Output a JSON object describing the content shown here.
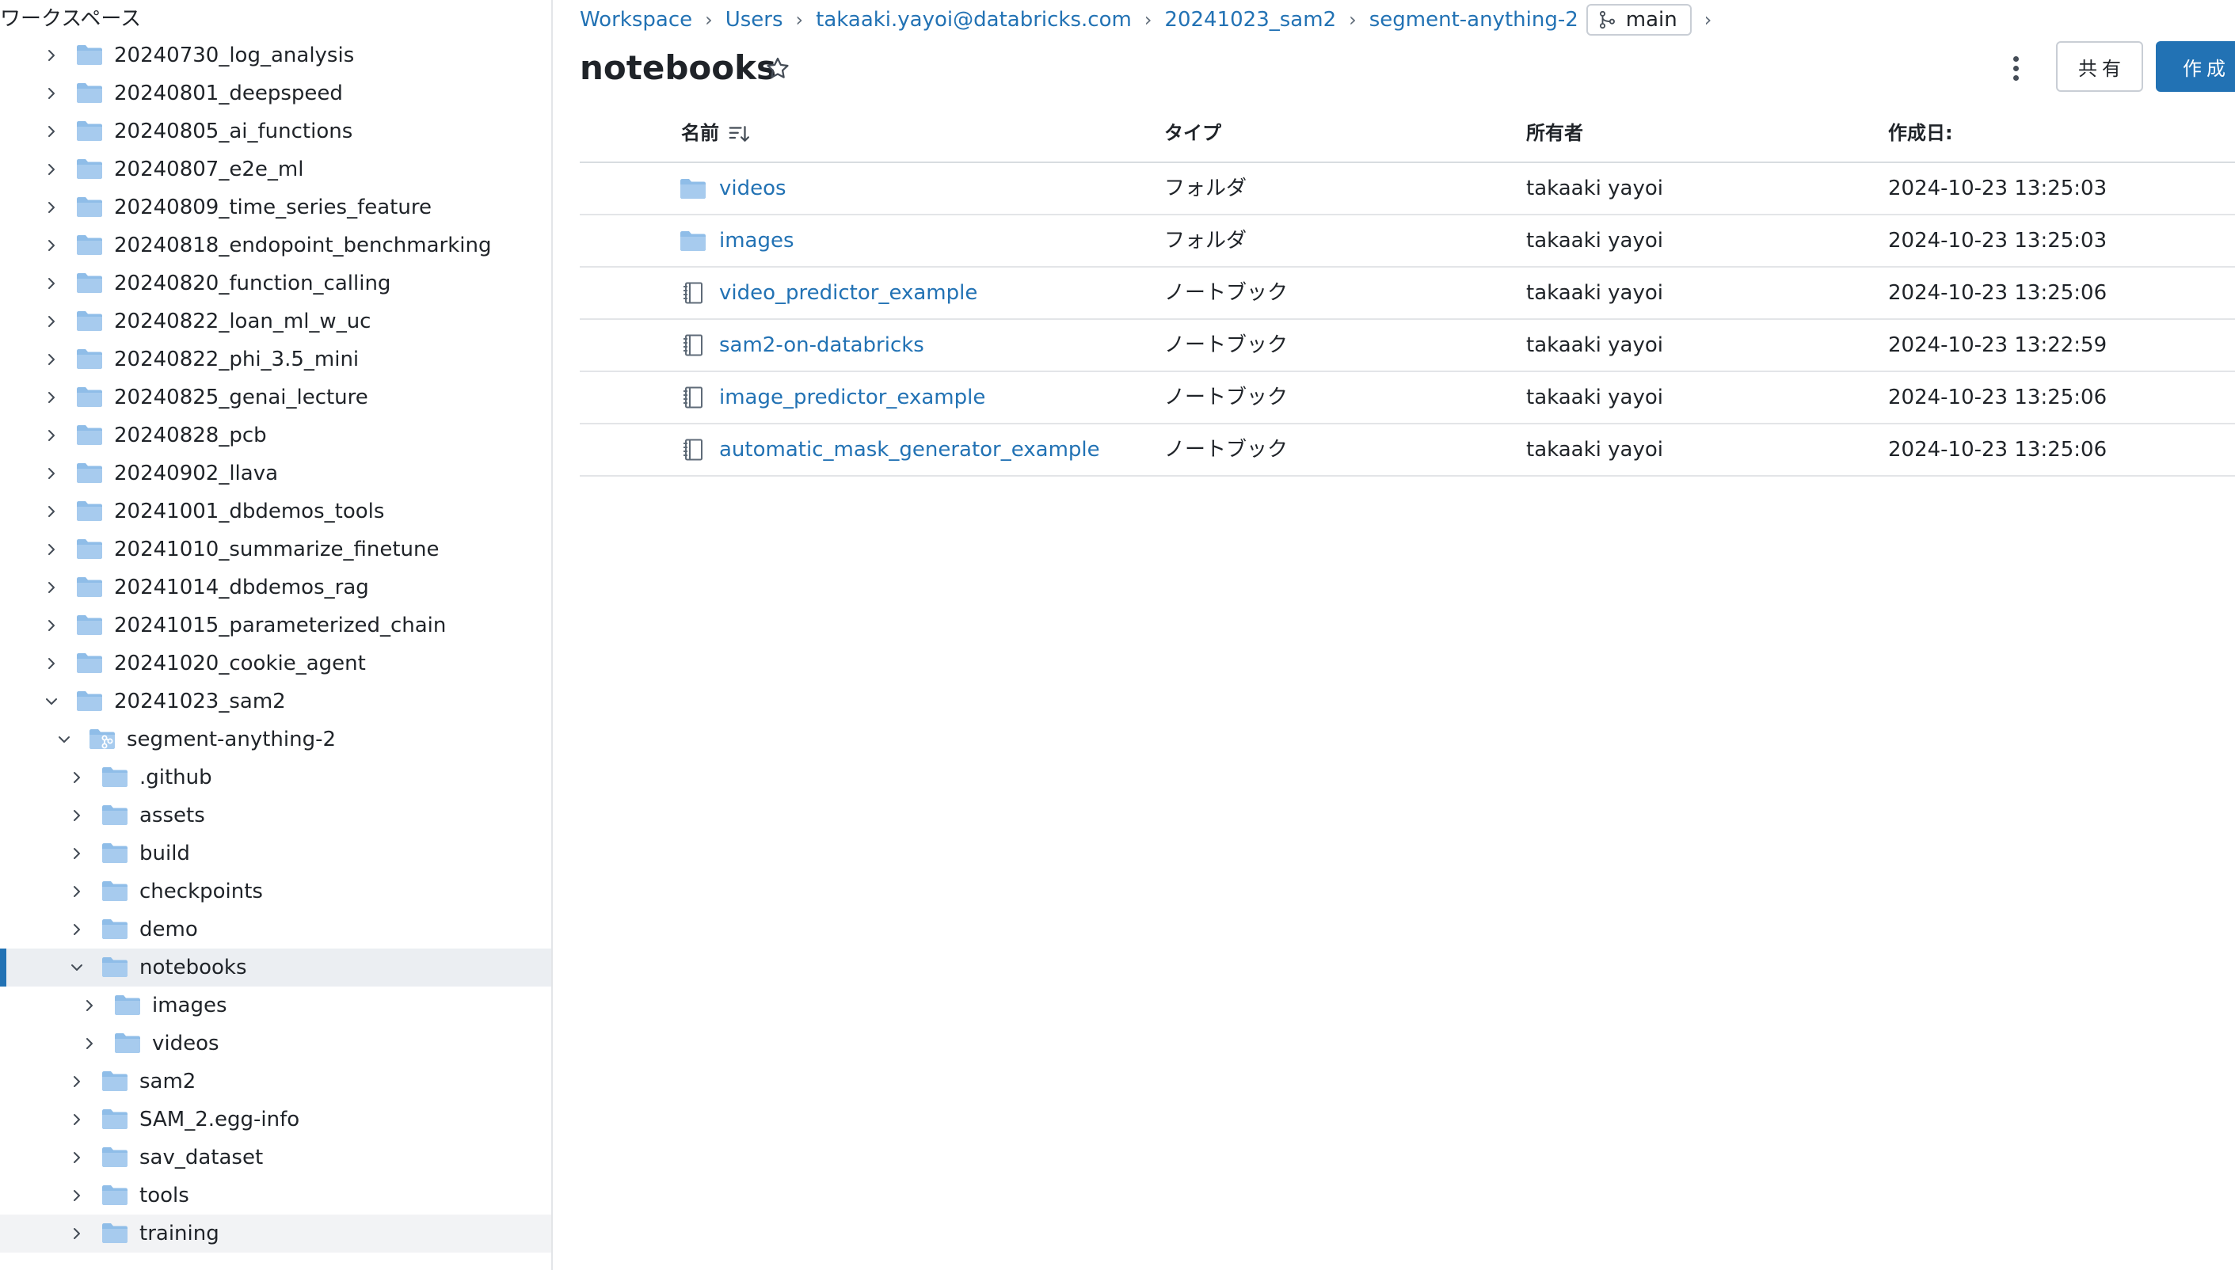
{
  "sidebar": {
    "title": "ワークスペース",
    "items": [
      {
        "label": "20240730_log_analysis",
        "level": 0,
        "expanded": false,
        "icon": "folder-icon"
      },
      {
        "label": "20240801_deepspeed",
        "level": 0,
        "expanded": false,
        "icon": "folder-icon"
      },
      {
        "label": "20240805_ai_functions",
        "level": 0,
        "expanded": false,
        "icon": "folder-icon"
      },
      {
        "label": "20240807_e2e_ml",
        "level": 0,
        "expanded": false,
        "icon": "folder-icon"
      },
      {
        "label": "20240809_time_series_feature",
        "level": 0,
        "expanded": false,
        "icon": "folder-icon"
      },
      {
        "label": "20240818_endopoint_benchmarking",
        "level": 0,
        "expanded": false,
        "icon": "folder-icon"
      },
      {
        "label": "20240820_function_calling",
        "level": 0,
        "expanded": false,
        "icon": "folder-icon"
      },
      {
        "label": "20240822_loan_ml_w_uc",
        "level": 0,
        "expanded": false,
        "icon": "folder-icon"
      },
      {
        "label": "20240822_phi_3.5_mini",
        "level": 0,
        "expanded": false,
        "icon": "folder-icon"
      },
      {
        "label": "20240825_genai_lecture",
        "level": 0,
        "expanded": false,
        "icon": "folder-icon"
      },
      {
        "label": "20240828_pcb",
        "level": 0,
        "expanded": false,
        "icon": "folder-icon"
      },
      {
        "label": "20240902_llava",
        "level": 0,
        "expanded": false,
        "icon": "folder-icon"
      },
      {
        "label": "20241001_dbdemos_tools",
        "level": 0,
        "expanded": false,
        "icon": "folder-icon"
      },
      {
        "label": "20241010_summarize_finetune",
        "level": 0,
        "expanded": false,
        "icon": "folder-icon"
      },
      {
        "label": "20241014_dbdemos_rag",
        "level": 0,
        "expanded": false,
        "icon": "folder-icon"
      },
      {
        "label": "20241015_parameterized_chain",
        "level": 0,
        "expanded": false,
        "icon": "folder-icon"
      },
      {
        "label": "20241020_cookie_agent",
        "level": 0,
        "expanded": false,
        "icon": "folder-icon"
      },
      {
        "label": "20241023_sam2",
        "level": 0,
        "expanded": true,
        "icon": "folder-icon"
      },
      {
        "label": "segment-anything-2",
        "level": 1,
        "expanded": true,
        "icon": "git-folder-icon"
      },
      {
        "label": ".github",
        "level": 2,
        "expanded": false,
        "icon": "folder-icon"
      },
      {
        "label": "assets",
        "level": 2,
        "expanded": false,
        "icon": "folder-icon"
      },
      {
        "label": "build",
        "level": 2,
        "expanded": false,
        "icon": "folder-icon"
      },
      {
        "label": "checkpoints",
        "level": 2,
        "expanded": false,
        "icon": "folder-icon"
      },
      {
        "label": "demo",
        "level": 2,
        "expanded": false,
        "icon": "folder-icon"
      },
      {
        "label": "notebooks",
        "level": 2,
        "expanded": true,
        "icon": "folder-icon",
        "selected": true
      },
      {
        "label": "images",
        "level": 3,
        "expanded": false,
        "icon": "folder-icon"
      },
      {
        "label": "videos",
        "level": 3,
        "expanded": false,
        "icon": "folder-icon"
      },
      {
        "label": "sam2",
        "level": 2,
        "expanded": false,
        "icon": "folder-icon"
      },
      {
        "label": "SAM_2.egg-info",
        "level": 2,
        "expanded": false,
        "icon": "folder-icon"
      },
      {
        "label": "sav_dataset",
        "level": 2,
        "expanded": false,
        "icon": "folder-icon"
      },
      {
        "label": "tools",
        "level": 2,
        "expanded": false,
        "icon": "folder-icon"
      },
      {
        "label": "training",
        "level": 2,
        "expanded": false,
        "icon": "folder-icon",
        "hovered": true
      }
    ]
  },
  "breadcrumb": {
    "items": [
      "Workspace",
      "Users",
      "takaaki.yayoi@databricks.com",
      "20241023_sam2",
      "segment-anything-2"
    ],
    "separator": "›",
    "branch": "main"
  },
  "header": {
    "title": "notebooks",
    "share_label": "共有",
    "create_label": "作成"
  },
  "table": {
    "columns": [
      "名前",
      "タイプ",
      "所有者",
      "作成日:"
    ],
    "rows": [
      {
        "name": "videos",
        "type": "フォルダ",
        "owner": "takaaki yayoi",
        "created": "2024-10-23 13:25:03",
        "icon": "folder-icon"
      },
      {
        "name": "images",
        "type": "フォルダ",
        "owner": "takaaki yayoi",
        "created": "2024-10-23 13:25:03",
        "icon": "folder-icon"
      },
      {
        "name": "video_predictor_example",
        "type": "ノートブック",
        "owner": "takaaki yayoi",
        "created": "2024-10-23 13:25:06",
        "icon": "notebook-icon"
      },
      {
        "name": "sam2-on-databricks",
        "type": "ノートブック",
        "owner": "takaaki yayoi",
        "created": "2024-10-23 13:22:59",
        "icon": "notebook-icon"
      },
      {
        "name": "image_predictor_example",
        "type": "ノートブック",
        "owner": "takaaki yayoi",
        "created": "2024-10-23 13:25:06",
        "icon": "notebook-icon"
      },
      {
        "name": "automatic_mask_generator_example",
        "type": "ノートブック",
        "owner": "takaaki yayoi",
        "created": "2024-10-23 13:25:06",
        "icon": "notebook-icon"
      }
    ]
  },
  "colors": {
    "accent": "#2272b4",
    "folder": "#8fbde8",
    "selected_bg": "#ebeef2",
    "text": "#1f2328"
  }
}
